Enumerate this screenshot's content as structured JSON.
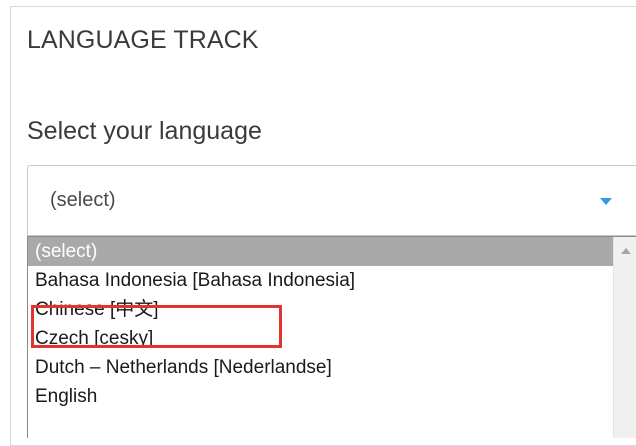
{
  "form": {
    "title": "LANGUAGE TRACK",
    "prompt": "Select your language",
    "select": {
      "current_value": "(select)",
      "caret_icon": "chevron-down-icon",
      "caret_color": "#2f9be0"
    }
  },
  "dropdown": {
    "options": [
      {
        "label": "(select)",
        "selected": true
      },
      {
        "label": "Bahasa Indonesia [Bahasa Indonesia]",
        "selected": false
      },
      {
        "label": "Chinese [中文]",
        "selected": false
      },
      {
        "label": "Czech [cesky]",
        "selected": false
      },
      {
        "label": "Dutch – Netherlands [Nederlandse]",
        "selected": false
      },
      {
        "label": "English",
        "selected": false
      }
    ],
    "selected_bg": "#a9a9a9",
    "scroll_up_icon": "arrow-up-icon"
  },
  "annotation": {
    "highlighted_option": "Chinese [中文]",
    "color": "#e0342f"
  }
}
